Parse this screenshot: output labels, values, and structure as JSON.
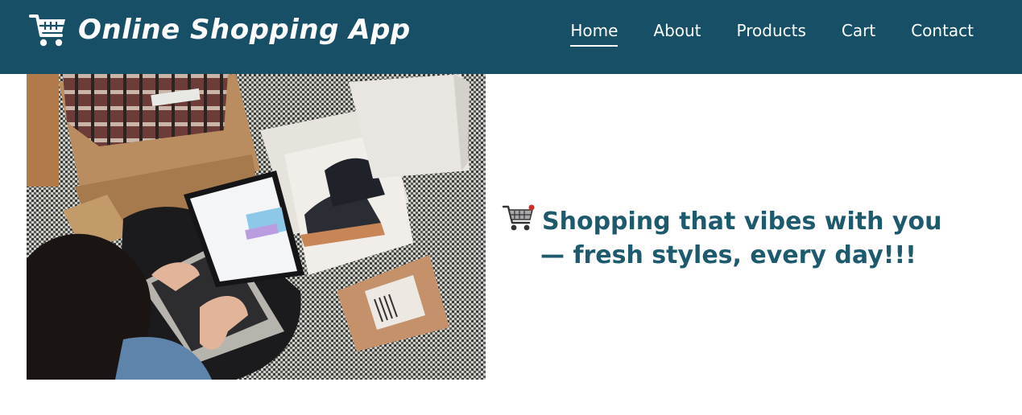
{
  "header": {
    "brand": "Online Shopping App",
    "logo_icon": "shopping-cart-icon",
    "bg_color": "#164f66"
  },
  "nav": {
    "items": [
      {
        "label": "Home",
        "active": true
      },
      {
        "label": "About",
        "active": false
      },
      {
        "label": "Products",
        "active": false
      },
      {
        "label": "Cart",
        "active": false
      },
      {
        "label": "Contact",
        "active": false
      }
    ]
  },
  "hero": {
    "image_icon": "hero-photo",
    "tagline_icon": "shopping-cart-emoji-icon",
    "tagline_line1": "Shopping that vibes with you",
    "tagline_line2": "— fresh styles, every day!!!",
    "tagline_color": "#1e5a6e"
  }
}
